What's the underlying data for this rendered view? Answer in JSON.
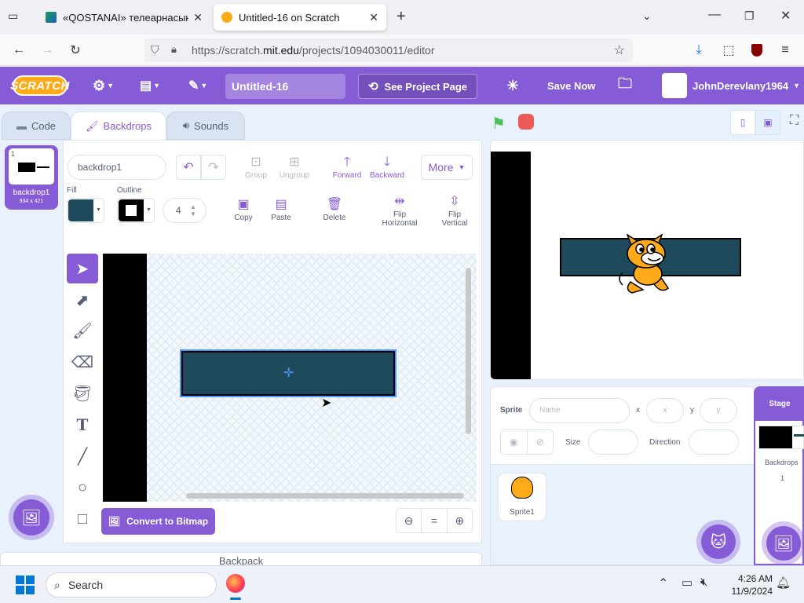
{
  "browser": {
    "tabs": [
      {
        "label": "«QOSTANAI» телеарнасының",
        "active": false
      },
      {
        "label": "Untitled-16 on Scratch",
        "active": true
      }
    ],
    "url_prefix": "https://scratch.",
    "url_domain": "mit.edu",
    "url_suffix": "/projects/1094030011/editor"
  },
  "menubar": {
    "logo": "SCRATCH",
    "project_title": "Untitled-16",
    "see_project": "See Project Page",
    "save_now": "Save Now",
    "username": "JohnDerevlany1964"
  },
  "editor_tabs": {
    "code": "Code",
    "backdrops": "Backdrops",
    "sounds": "Sounds"
  },
  "costumes": [
    {
      "index": "1",
      "name": "backdrop1",
      "size": "934 x 421"
    }
  ],
  "paint": {
    "costume_name": "backdrop1",
    "fill_label": "Fill",
    "outline_label": "Outline",
    "outline_width": "4",
    "fill_color": "#1e4a5c",
    "outline_color": "#000000",
    "group": "Group",
    "ungroup": "Ungroup",
    "forward": "Forward",
    "backward": "Backward",
    "more": "More",
    "copy": "Copy",
    "paste": "Paste",
    "delete": "Delete",
    "flip_h_1": "Flip",
    "flip_h_2": "Horizontal",
    "flip_v_1": "Flip",
    "flip_v_2": "Vertical",
    "convert": "Convert to Bitmap",
    "zoom_reset": "="
  },
  "backpack": "Backpack",
  "sprite_info": {
    "sprite_label": "Sprite",
    "name_placeholder": "Name",
    "x_label": "x",
    "x_placeholder": "x",
    "y_label": "y",
    "y_placeholder": "y",
    "size_label": "Size",
    "direction_label": "Direction"
  },
  "sprites": [
    {
      "name": "Sprite1"
    }
  ],
  "stage_panel": {
    "title": "Stage",
    "backdrops_label": "Backdrops",
    "backdrops_count": "1"
  },
  "taskbar": {
    "search": "Search",
    "time": "4:26 AM",
    "date": "11/9/2024"
  },
  "colors": {
    "accent": "#855cd6",
    "shape_fill": "#1e4a5c",
    "cat_orange": "#ffab19"
  }
}
